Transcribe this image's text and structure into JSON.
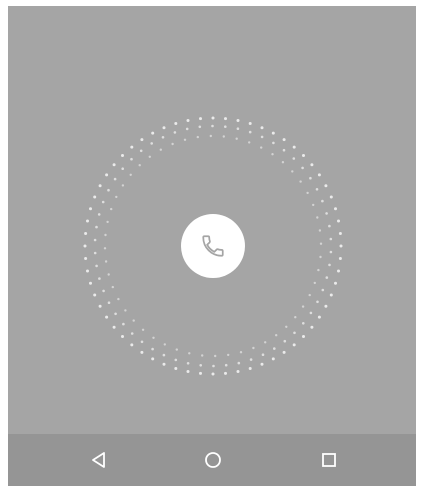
{
  "screen": {
    "background_color": "#a5a5a5",
    "ring_color": "#f2f2f2"
  },
  "call_button": {
    "icon": "phone-icon",
    "background_color": "#ffffff",
    "icon_color": "#a5a5a5"
  },
  "navbar": {
    "background_color": "#959595",
    "icon_color": "#ffffff",
    "buttons": [
      {
        "icon": "back-triangle-icon"
      },
      {
        "icon": "home-circle-icon"
      },
      {
        "icon": "recents-square-icon"
      }
    ]
  }
}
